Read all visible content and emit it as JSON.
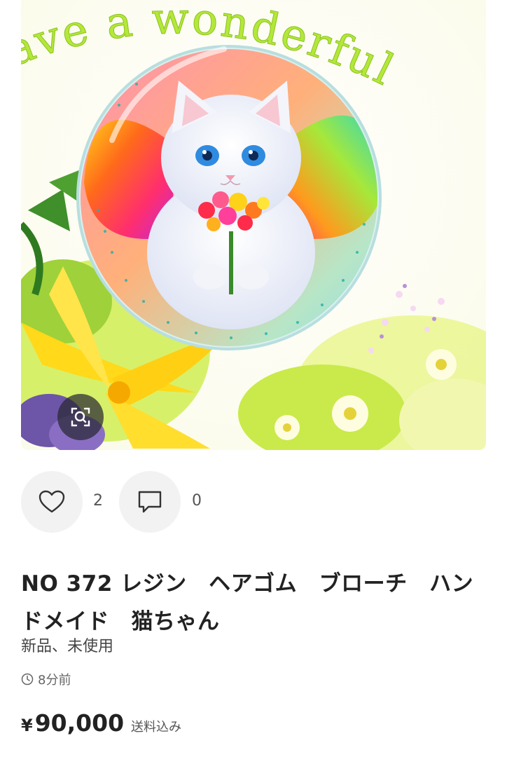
{
  "image": {
    "banner_text": "ave a wonderful",
    "lens_icon": "image-search-icon"
  },
  "actions": {
    "like": {
      "icon": "heart-icon",
      "count": "2"
    },
    "comment": {
      "icon": "comment-icon",
      "count": "0"
    }
  },
  "product": {
    "title": "NO 372 レジン　ヘアゴム　ブローチ　ハンドメイド　猫ちゃん",
    "condition": "新品、未使用",
    "posted_time": "8分前",
    "currency_symbol": "¥",
    "price": "90,000",
    "shipping_note": "送料込み"
  },
  "colors": {
    "text_primary": "#222222",
    "text_secondary": "#666666",
    "button_bg": "#f2f2f2",
    "banner_green": "#a8e02a"
  }
}
